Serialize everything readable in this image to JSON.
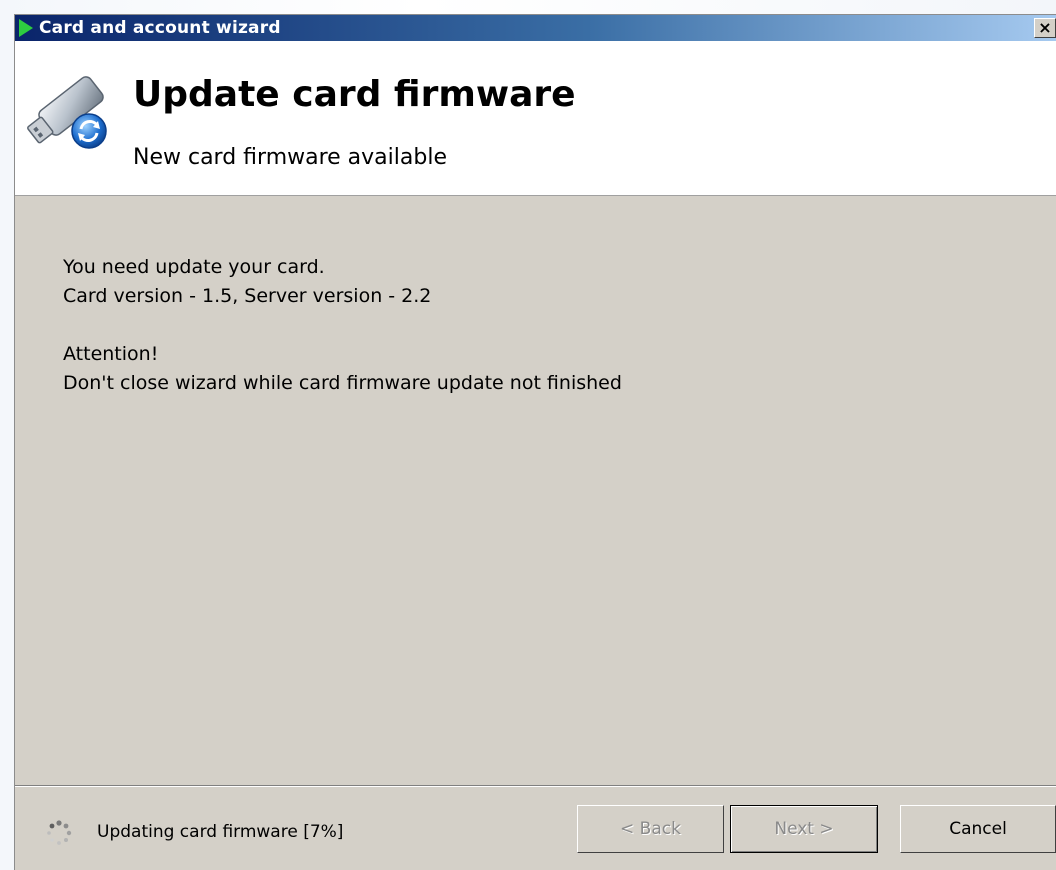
{
  "window": {
    "title": "Card and account wizard",
    "close_label": "✕",
    "title_icon": "green-play-arrow-icon"
  },
  "header": {
    "icon": "usb-card-update-icon",
    "title": "Update card firmware",
    "subtitle": "New card firmware available"
  },
  "content": {
    "line1": "You need update your card.",
    "line2": "Card version - 1.5, Server version - 2.2",
    "line3": "Attention!",
    "line4": "Don't close wizard while card firmware update not finished"
  },
  "status": {
    "icon": "spinner-icon",
    "text": "Updating card firmware [7%]",
    "progress_percent": 7
  },
  "buttons": {
    "back": "< Back",
    "next": "Next >",
    "cancel": "Cancel"
  },
  "colors": {
    "titlebar_start": "#0a246a",
    "titlebar_end": "#a6caf0",
    "dialog_background": "#d4d0c8"
  }
}
